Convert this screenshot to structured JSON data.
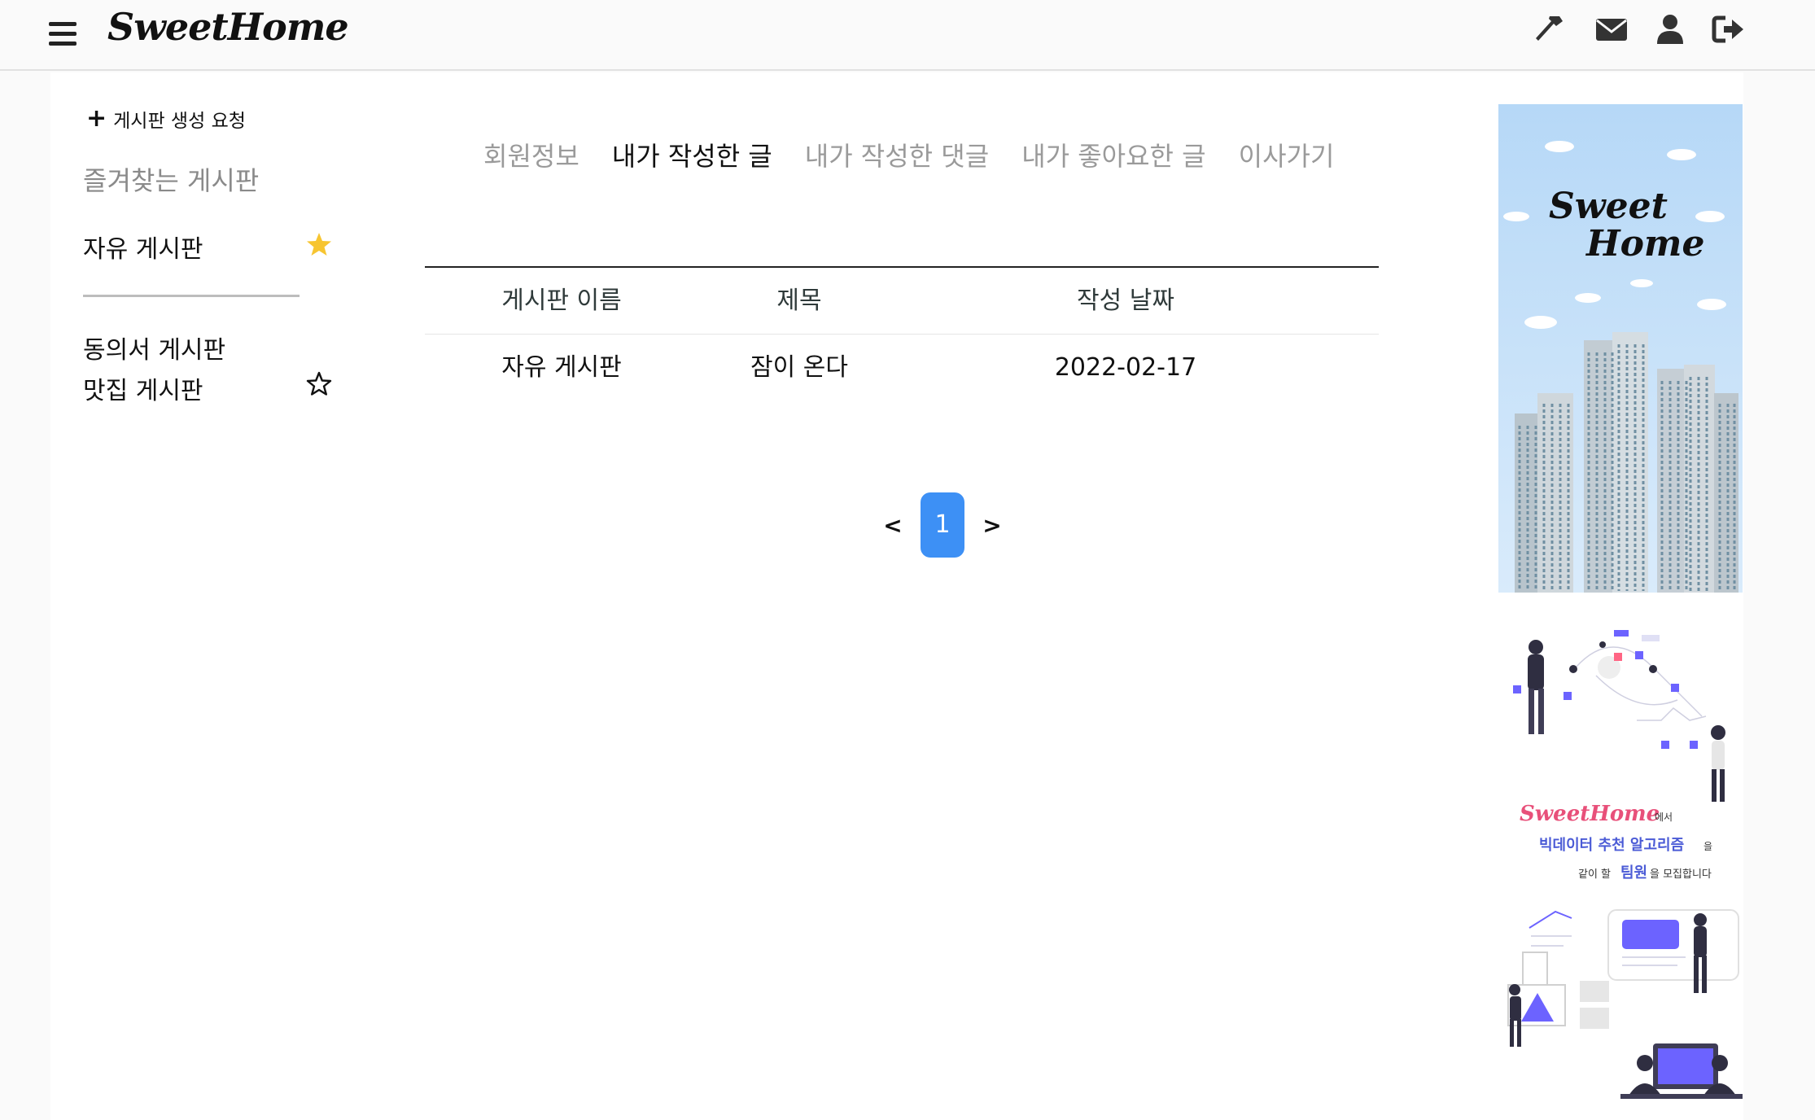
{
  "header": {
    "logo": "SweetHome",
    "icons": [
      "hammer-icon",
      "envelope-icon",
      "user-icon",
      "logout-icon"
    ]
  },
  "sidebar": {
    "request_label": "게시판 생성 요청",
    "favorites_title": "즐겨찾는 게시판",
    "favorites": [
      {
        "label": "자유 게시판",
        "starred": true
      }
    ],
    "boards": [
      {
        "label": "동의서 게시판",
        "starred": false
      },
      {
        "label": "맛집 게시판",
        "starred": false
      }
    ]
  },
  "tabs": [
    {
      "label": "회원정보",
      "active": false
    },
    {
      "label": "내가 작성한 글",
      "active": true
    },
    {
      "label": "내가 작성한 댓글",
      "active": false
    },
    {
      "label": "내가 좋아요한 글",
      "active": false
    },
    {
      "label": "이사가기",
      "active": false
    }
  ],
  "table": {
    "columns": [
      "게시판 이름",
      "제목",
      "작성 날짜"
    ],
    "rows": [
      [
        "자유 게시판",
        "잠이 온다",
        "2022-02-17"
      ]
    ]
  },
  "pagination": {
    "prev": "<",
    "current": "1",
    "next": ">"
  },
  "ads": {
    "banner_logo_line1": "Sweet",
    "banner_logo_line2": "Home",
    "recruit_brand": "SweetHome",
    "recruit_suffix": "에서",
    "recruit_line2": "빅데이터 추천 알고리즘",
    "recruit_line2_suffix": "을",
    "recruit_line3_prefix": "같이 할",
    "recruit_line3_em": "팀원",
    "recruit_line3_suffix": "을 모집합니다"
  },
  "colors": {
    "accent": "#3d90f5",
    "star_filled": "#f7c531",
    "brand_pink": "#e8507a",
    "recruit_blue": "#4b5bd6"
  }
}
